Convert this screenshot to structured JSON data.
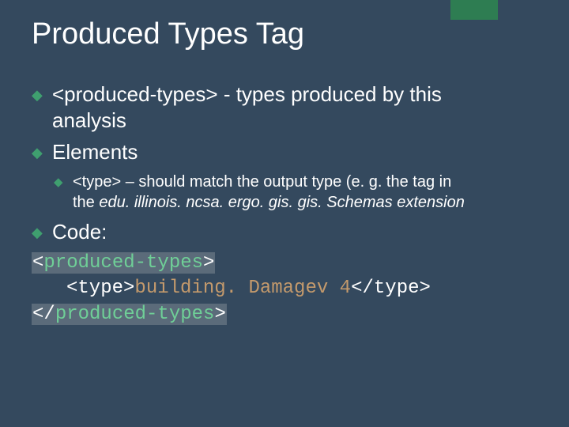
{
  "title": "Produced Types Tag",
  "bullets": {
    "b1": {
      "tag": "<produced-types>",
      "desc": " - types produced by this",
      "cont": "analysis"
    },
    "b2": {
      "label": "Elements"
    },
    "b2a": {
      "tag": "<type>",
      "desc": " – should match the output type (e. g. the tag in",
      "cont_pre": "the ",
      "cont_em": "edu. illinois. ncsa. ergo. gis. gis. Schemas extension"
    },
    "b3": {
      "label": "Code:"
    }
  },
  "code": {
    "l1_lt": "<",
    "l1_name": "produced-types",
    "l1_gt": ">",
    "l2_open": "<type>",
    "l2_text": "building. Damagev 4",
    "l2_close": "</type>",
    "l3_lt": "</",
    "l3_name": "produced-types",
    "l3_gt": ">"
  }
}
